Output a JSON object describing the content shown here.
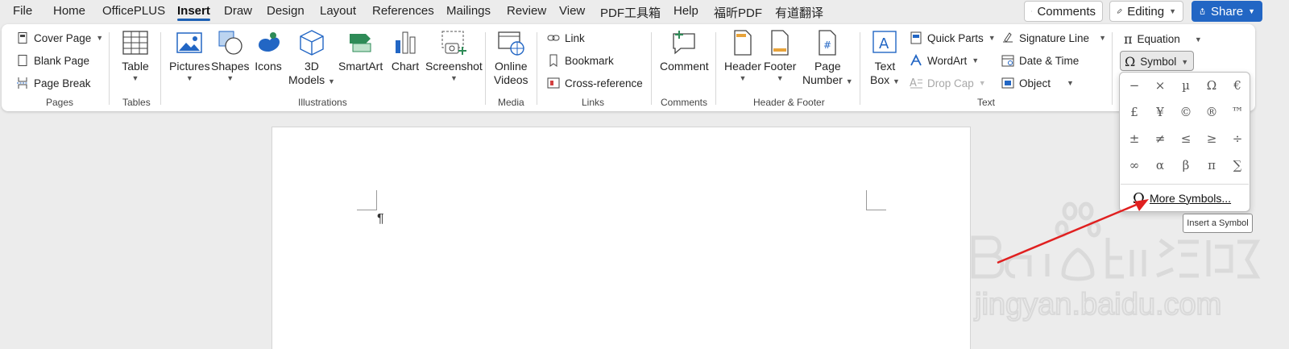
{
  "menubar": {
    "items": [
      "File",
      "Home",
      "OfficePLUS",
      "Insert",
      "Draw",
      "Design",
      "Layout",
      "References",
      "Mailings",
      "Review",
      "View",
      "PDF工具箱",
      "Help",
      "福昕PDF",
      "有道翻译"
    ],
    "active_index": 3
  },
  "top_buttons": {
    "comments": "Comments",
    "editing": "Editing",
    "share": "Share"
  },
  "ribbon": {
    "pages": {
      "label": "Pages",
      "cover_page": "Cover Page",
      "blank_page": "Blank Page",
      "page_break": "Page Break"
    },
    "tables": {
      "label": "Tables",
      "table": "Table"
    },
    "illustrations": {
      "label": "Illustrations",
      "pictures": "Pictures",
      "shapes": "Shapes",
      "icons": "Icons",
      "models_3d_line1": "3D",
      "models_3d_line2": "Models",
      "smartart": "SmartArt",
      "chart": "Chart",
      "screenshot": "Screenshot"
    },
    "media": {
      "label": "Media",
      "online_line1": "Online",
      "online_line2": "Videos"
    },
    "links": {
      "label": "Links",
      "link": "Link",
      "bookmark": "Bookmark",
      "cross_reference": "Cross-reference"
    },
    "comments": {
      "label": "Comments",
      "comment": "Comment"
    },
    "header_footer": {
      "label": "Header & Footer",
      "header": "Header",
      "footer": "Footer",
      "page_line1": "Page",
      "page_line2": "Number"
    },
    "text": {
      "label": "Text",
      "textbox_line1": "Text",
      "textbox_line2": "Box",
      "quick_parts": "Quick Parts",
      "wordart": "WordArt",
      "drop_cap": "Drop Cap",
      "signature_line": "Signature Line",
      "date_time": "Date & Time",
      "object": "Object"
    },
    "symbols": {
      "equation": "Equation",
      "symbol": "Symbol"
    }
  },
  "document": {
    "pilcrow": "¶"
  },
  "symbol_panel": {
    "symbols": [
      "−",
      "×",
      "µ",
      "Ω",
      "€",
      "£",
      "¥",
      "©",
      "®",
      "™",
      "±",
      "≠",
      "≤",
      "≥",
      "÷",
      "∞",
      "α",
      "β",
      "π",
      "∑"
    ],
    "more_symbols": "More Symbols...",
    "tooltip": "Insert a Symbol"
  },
  "colors": {
    "accent": "#2266c4",
    "arrow": "#e02020"
  }
}
